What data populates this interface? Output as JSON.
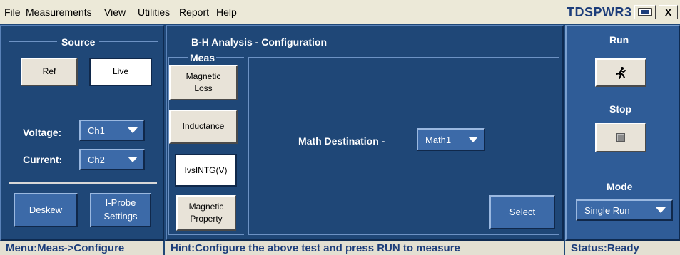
{
  "menu": {
    "items": [
      {
        "label": "File"
      },
      {
        "label": "Measurements"
      },
      {
        "label": "View"
      },
      {
        "label": "Utilities"
      },
      {
        "label": "Report"
      },
      {
        "label": "Help"
      }
    ],
    "app_title": "TDSPWR3",
    "close_label": "X"
  },
  "source": {
    "title": "Source",
    "ref_label": "Ref",
    "live_label": "Live"
  },
  "channels": {
    "voltage_label": "Voltage:",
    "voltage_value": "Ch1",
    "current_label": "Current:",
    "current_value": "Ch2"
  },
  "bottom_buttons": {
    "deskew_label": "Deskew",
    "iprobe_label_line1": "I-Probe",
    "iprobe_label_line2": "Settings"
  },
  "config": {
    "title": "B-H Analysis - Configuration",
    "meas_title": "Meas",
    "meas_items": [
      {
        "line1": "Magnetic",
        "line2": "Loss"
      },
      {
        "line1": "Inductance",
        "line2": ""
      },
      {
        "line1": "IvsINTG(V)",
        "line2": ""
      },
      {
        "line1": "Magnetic",
        "line2": "Property"
      }
    ],
    "math_destination_label": "Math Destination -",
    "math_destination_value": "Math1",
    "select_label": "Select"
  },
  "run_panel": {
    "run_title": "Run",
    "stop_title": "Stop",
    "mode_title": "Mode",
    "mode_value": "Single Run"
  },
  "status": {
    "menu": "Menu:Meas->Configure",
    "hint": "Hint:Configure the above test and press RUN to measure",
    "state": "Status:Ready"
  }
}
